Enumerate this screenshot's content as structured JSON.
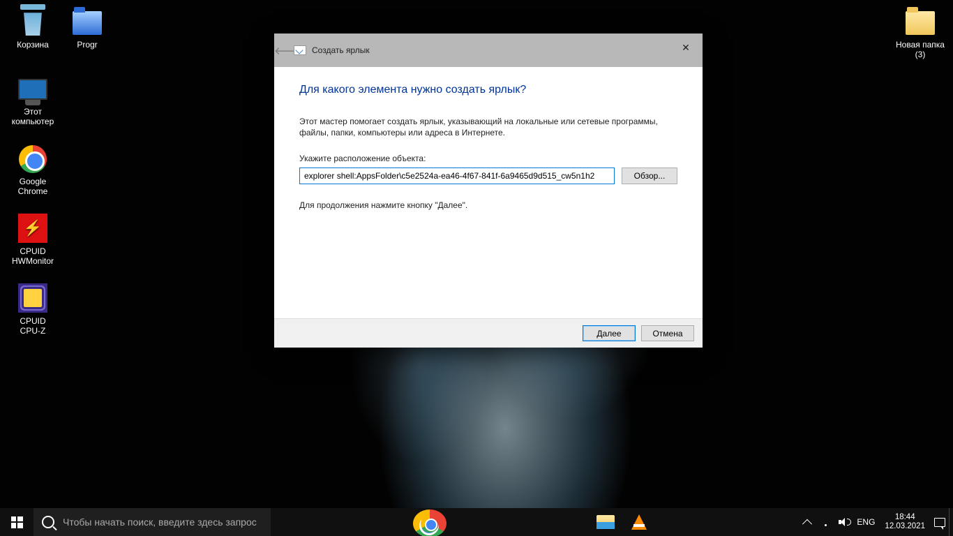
{
  "desktop_icons": {
    "recycle": "Корзина",
    "progr": "Progr",
    "thispc_l1": "Этот",
    "thispc_l2": "компьютер",
    "chrome_l1": "Google",
    "chrome_l2": "Chrome",
    "hwm_l1": "CPUID",
    "hwm_l2": "HWMonitor",
    "cpuz_l1": "CPUID",
    "cpuz_l2": "CPU-Z",
    "newfolder_l1": "Новая папка",
    "newfolder_l2": "(3)"
  },
  "dialog": {
    "title": "Создать ярлык",
    "heading": "Для какого элемента нужно создать ярлык?",
    "intro": "Этот мастер помогает создать ярлык, указывающий на локальные или сетевые программы, файлы, папки, компьютеры или адреса в Интернете.",
    "label": "Укажите расположение объекта:",
    "value": "explorer shell:AppsFolder\\c5e2524a-ea46-4f67-841f-6a9465d9d515_cw5n1h2",
    "browse": "Обзор...",
    "continue_hint": "Для продолжения нажмите кнопку \"Далее\".",
    "next": "Далее",
    "cancel": "Отмена"
  },
  "taskbar": {
    "search_placeholder": "Чтобы начать поиск, введите здесь запрос",
    "lang": "ENG",
    "time": "18:44",
    "date": "12.03.2021"
  }
}
